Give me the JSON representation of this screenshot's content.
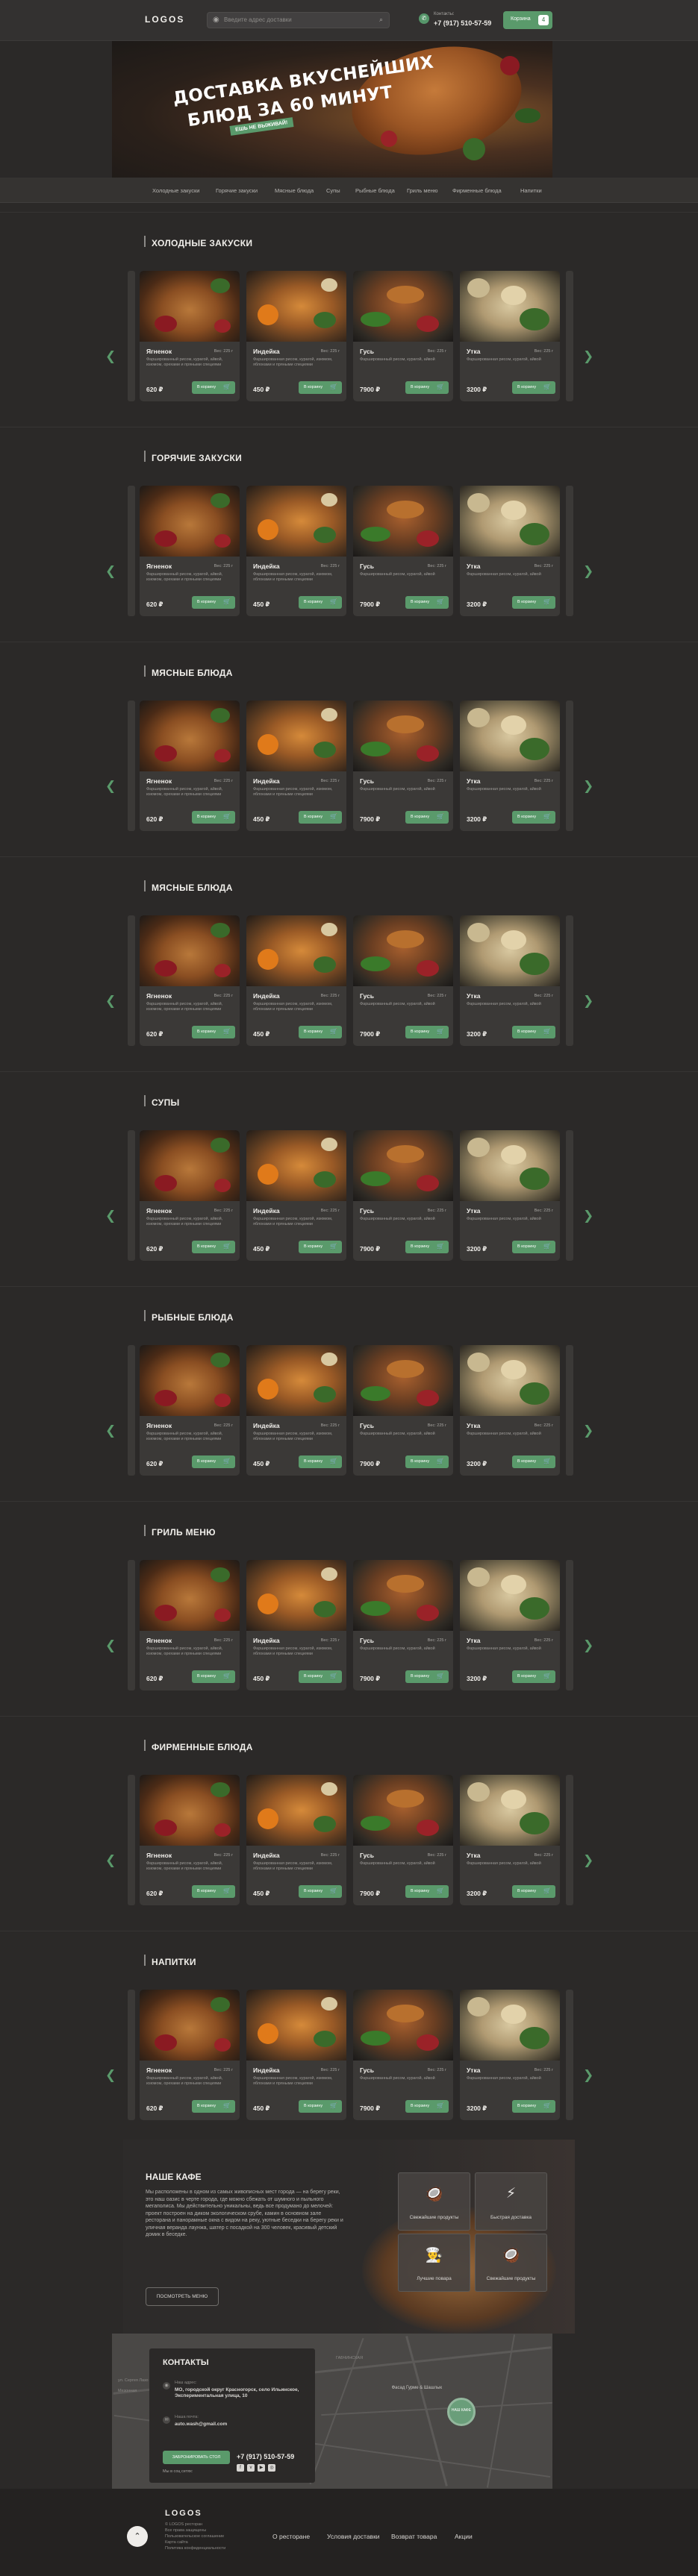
{
  "header": {
    "logo": "LOGOS",
    "search_placeholder": "Введите адрес доставки",
    "phone_caption": "Контакты:",
    "phone": "+7 (917) 510-57-59",
    "cart_label": "Корзина",
    "cart_count": "4"
  },
  "hero": {
    "title_line1": "ДОСТАВКА ВКУСНЕЙШИХ",
    "title_line2": "БЛЮД ЗА 60 МИНУТ",
    "badge": "ЕШЬ НЕ ВЫЖИВАЙ!"
  },
  "nav": {
    "items": [
      "Холодные закуски",
      "Горячие закуски",
      "Мясные блюда",
      "Супы",
      "Рыбные блюда",
      "Гриль меню",
      "Фирменные блюда",
      "Напитки"
    ]
  },
  "cards": [
    {
      "name": "Ягненок",
      "weight": "Вес: 225 г",
      "desc": "Фаршированный рисом, курагой, айвой, изюмом, орехами и пряными специями",
      "price": "620 ₽",
      "button": "В корзину"
    },
    {
      "name": "Индейка",
      "weight": "Вес: 225 г",
      "desc": "Фаршированная рисом, курагой, изюмом, яблоками и пряными специями",
      "price": "450 ₽",
      "button": "В корзину"
    },
    {
      "name": "Гусь",
      "weight": "Вес: 225 г",
      "desc": "Фаршированный рисом, курагой, айвой",
      "price": "7900 ₽",
      "button": "В корзину"
    },
    {
      "name": "Утка",
      "weight": "Вес: 225 г",
      "desc": "Фаршированная рисом, курагой, айвой",
      "price": "3200 ₽",
      "button": "В корзину"
    }
  ],
  "sections": [
    {
      "title": "ХОЛОДНЫЕ ЗАКУСКИ"
    },
    {
      "title": "ГОРЯЧИЕ ЗАКУСКИ"
    },
    {
      "title": "МЯСНЫЕ БЛЮДА"
    },
    {
      "title": "МЯСНЫЕ БЛЮДА"
    },
    {
      "title": "СУПЫ"
    },
    {
      "title": "РЫБНЫЕ БЛЮДА"
    },
    {
      "title": "ГРИЛЬ МЕНЮ"
    },
    {
      "title": "ФИРМЕННЫЕ БЛЮДА"
    },
    {
      "title": "НАПИТКИ"
    }
  ],
  "cafe": {
    "title": "НАШЕ КАФЕ",
    "text": "Мы расположены в одном из самых живописных мест города — на берегу реки, это наш оазис в черте города, где можно сбежать от шумного и пыльного мегаполиса. Мы действительно уникальны, ведь все продумано до мелочей: проект построен на диком экологическом срубе, камин в основном зале ресторана и панорамные окна с видом на реку, уютные беседки на берегу реки и уличная веранда лаунжа, шатер с посадкой на 300 человек, красивый детский домик в беседке.",
    "button": "ПОСМОТРЕТЬ МЕНЮ",
    "features": [
      {
        "label": "Свежайшие продукты",
        "icon": "🥥"
      },
      {
        "label": "Быстрая доставка",
        "icon": "⚡"
      },
      {
        "label": "Лучшие повара",
        "icon": "👨‍🍳"
      },
      {
        "label": "Свежайшие продукты",
        "icon": "🥥"
      }
    ]
  },
  "map": {
    "pin_text": "НАШ КАФЕ",
    "pin_label": "Фасад Гурме & Шашлык",
    "labels": [
      "ул. Сергея Лазо",
      "Мезонная",
      "ГАБЧИНСКАЯ"
    ]
  },
  "contacts": {
    "title": "КОНТАКТЫ",
    "address_caption": "Наш адрес:",
    "address": "МО, городской округ Красногорск, село Ильинское, Экспериментальная улица, 10",
    "email_caption": "Наша почта:",
    "email": "auto.wash@gmail.com",
    "button": "ЗАБРОНИРОВАТЬ СТОЛ",
    "phone": "+7 (917) 510-57-59",
    "social_caption": "Мы в соц сетях:"
  },
  "footer": {
    "logo": "LOGOS",
    "lines": [
      "© LOGOS ресторан",
      "Все права защищены",
      "Пользовательское соглашение",
      "Карта сайта",
      "Политика конфиденциальности"
    ],
    "links": [
      "О ресторане",
      "Условия доставки",
      "Возврат товара",
      "Акции"
    ]
  },
  "colors": {
    "accent": "#5a9a6b",
    "background": "#2b2928",
    "card": "#3b3937"
  }
}
